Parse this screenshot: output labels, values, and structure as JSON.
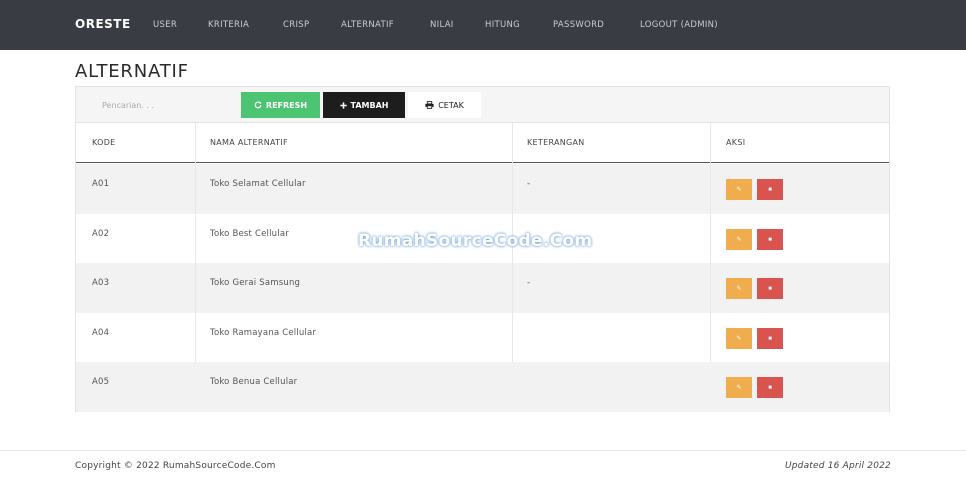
{
  "navbar": {
    "brand": "ORESTE",
    "items": [
      {
        "label": "USER"
      },
      {
        "label": "KRITERIA"
      },
      {
        "label": "CRISP"
      },
      {
        "label": "ALTERNATIF"
      },
      {
        "label": "NILAI"
      },
      {
        "label": "HITUNG"
      },
      {
        "label": "PASSWORD"
      },
      {
        "label": "LOGOUT (ADMIN)"
      }
    ]
  },
  "page": {
    "title": "ALTERNATIF"
  },
  "toolbar": {
    "search_placeholder": "Pencarian. . .",
    "refresh_label": "REFRESH",
    "tambah_label": "TAMBAH",
    "cetak_label": "CETAK"
  },
  "table": {
    "headers": [
      "KODE",
      "NAMA ALTERNATIF",
      "KETERANGAN",
      "AKSI"
    ],
    "rows": [
      {
        "kode": "A01",
        "nama": "Toko Selamat Cellular",
        "keterangan": "-"
      },
      {
        "kode": "A02",
        "nama": "Toko Best Cellular",
        "keterangan": "-"
      },
      {
        "kode": "A03",
        "nama": "Toko Gerai Samsung",
        "keterangan": "-"
      },
      {
        "kode": "A04",
        "nama": "Toko Ramayana Cellular",
        "keterangan": ""
      },
      {
        "kode": "A05",
        "nama": "Toko Benua Cellular",
        "keterangan": ""
      }
    ]
  },
  "watermark": "RumahSourceCode.Com",
  "footer": {
    "copyright": "Copyright © 2022 RumahSourceCode.Com",
    "updated": "Updated 16 April 2022"
  },
  "icons": {
    "refresh": "refresh-icon",
    "tambah": "plus-icon",
    "cetak": "print-icon",
    "edit": "edit-icon",
    "delete": "trash-icon"
  },
  "colors": {
    "navbar": "#393d43",
    "refresh": "#4cc472",
    "tambah": "#1d1d1d",
    "edit": "#f0ad4e",
    "delete": "#d9534f"
  }
}
